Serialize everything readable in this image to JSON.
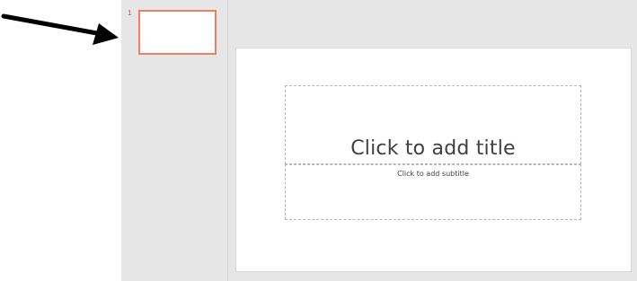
{
  "thumbnail_pane": {
    "slides": [
      {
        "number": "1"
      }
    ]
  },
  "slide": {
    "title_placeholder": "Click to add title",
    "subtitle_placeholder": "Click to add subtitle"
  },
  "colors": {
    "selected_thumb_border": "#ef7e62",
    "pane_background": "#e6e6e6",
    "annotation_arrow": "#000000"
  },
  "icons": {
    "annotation": "arrow-pointer-icon"
  }
}
